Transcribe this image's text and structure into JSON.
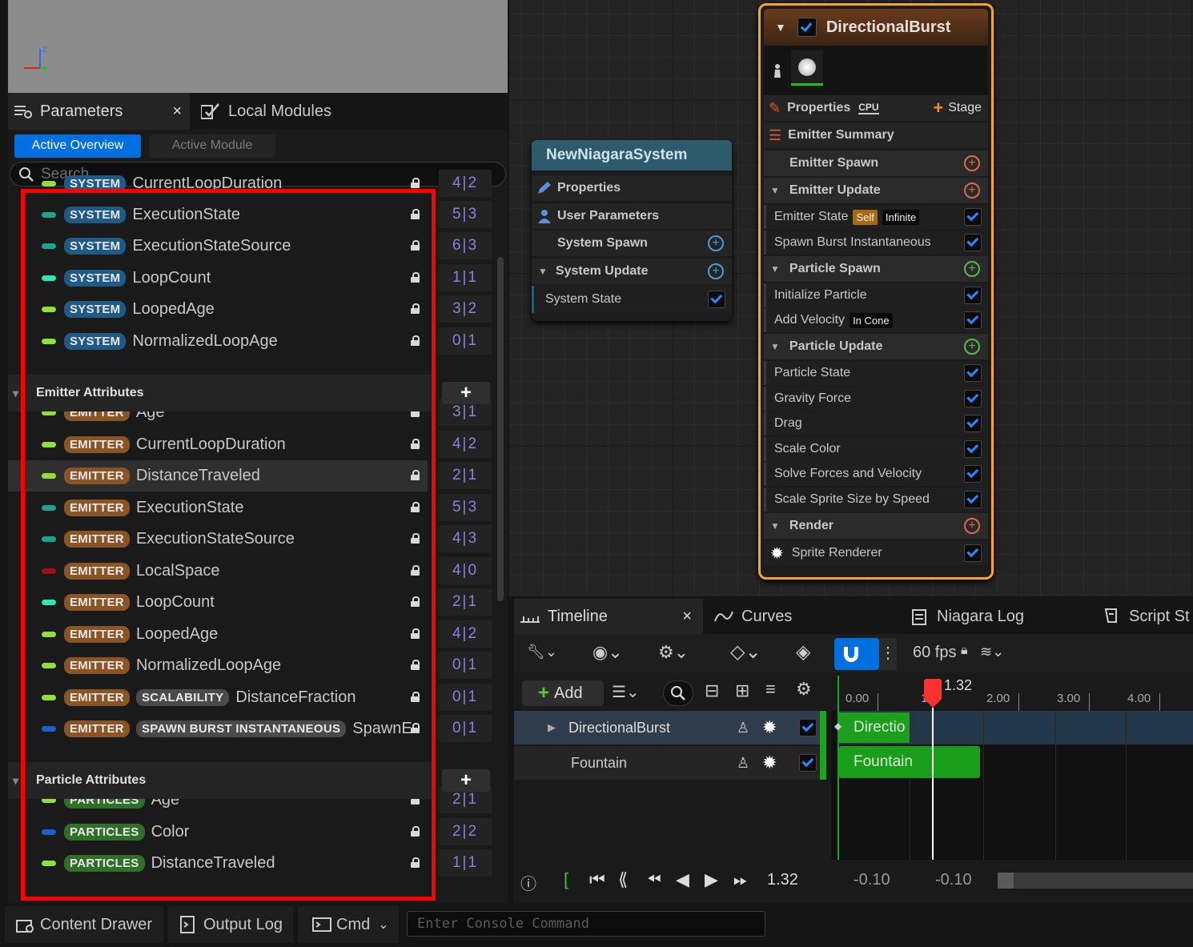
{
  "tabs": {
    "parameters": "Parameters",
    "local_modules": "Local Modules"
  },
  "subtabs": {
    "active_overview": "Active Overview",
    "active_module": "Active Module"
  },
  "search": {
    "placeholder": "Search"
  },
  "system_rows": [
    {
      "tag": "SYSTEM",
      "name": "CurrentLoopDuration",
      "count": "4|2",
      "pill": "#8fe03c"
    },
    {
      "tag": "SYSTEM",
      "name": "ExecutionState",
      "count": "5|3",
      "pill": "#1aa58c"
    },
    {
      "tag": "SYSTEM",
      "name": "ExecutionStateSource",
      "count": "6|3",
      "pill": "#1aa58c"
    },
    {
      "tag": "SYSTEM",
      "name": "LoopCount",
      "count": "1|1",
      "pill": "#2ee6b6"
    },
    {
      "tag": "SYSTEM",
      "name": "LoopedAge",
      "count": "3|2",
      "pill": "#8fe03c"
    },
    {
      "tag": "SYSTEM",
      "name": "NormalizedLoopAge",
      "count": "0|1",
      "pill": "#8fe03c"
    }
  ],
  "emitter_section": "Emitter Attributes",
  "emitter_rows": [
    {
      "tag": "EMITTER",
      "name": "Age",
      "count": "3|1",
      "pill": "#8fe03c"
    },
    {
      "tag": "EMITTER",
      "name": "CurrentLoopDuration",
      "count": "4|2",
      "pill": "#8fe03c"
    },
    {
      "tag": "EMITTER",
      "name": "DistanceTraveled",
      "count": "2|1",
      "pill": "#8fe03c"
    },
    {
      "tag": "EMITTER",
      "name": "ExecutionState",
      "count": "5|3",
      "pill": "#1aa58c"
    },
    {
      "tag": "EMITTER",
      "name": "ExecutionStateSource",
      "count": "4|3",
      "pill": "#1aa58c"
    },
    {
      "tag": "EMITTER",
      "name": "LocalSpace",
      "count": "4|0",
      "pill": "#a01010"
    },
    {
      "tag": "EMITTER",
      "name": "LoopCount",
      "count": "2|1",
      "pill": "#2ee6b6"
    },
    {
      "tag": "EMITTER",
      "name": "LoopedAge",
      "count": "4|2",
      "pill": "#8fe03c"
    },
    {
      "tag": "EMITTER",
      "name": "NormalizedLoopAge",
      "count": "0|1",
      "pill": "#8fe03c"
    },
    {
      "tag": "EMITTER",
      "tag2": "SCALABILITY",
      "name": "DistanceFraction",
      "count": "0|1",
      "pill": "#8fe03c"
    },
    {
      "tag": "EMITTER",
      "tag2": "SPAWN BURST INSTANTANEOUS",
      "name": "SpawnE",
      "count": "0|1",
      "pill": "#1a5fd0"
    }
  ],
  "particle_section": "Particle Attributes",
  "particle_rows": [
    {
      "tag": "PARTICLES",
      "name": "Age",
      "count": "2|1",
      "pill": "#8fe03c"
    },
    {
      "tag": "PARTICLES",
      "name": "Color",
      "count": "2|2",
      "pill": "#1a5fd0"
    },
    {
      "tag": "PARTICLES",
      "name": "DistanceTraveled",
      "count": "1|1",
      "pill": "#8fe03c"
    }
  ],
  "system_node": {
    "title": "NewNiagaraSystem",
    "properties": "Properties",
    "user_parameters": "User Parameters",
    "system_spawn": "System Spawn",
    "system_update": "System Update",
    "system_state": "System State"
  },
  "emitter_node": {
    "title": "DirectionalBurst",
    "properties": "Properties",
    "cpu": "CPU",
    "stage": "Stage",
    "emitter_summary": "Emitter Summary",
    "emitter_spawn": "Emitter Spawn",
    "emitter_update": "Emitter Update",
    "emitter_state": "Emitter State",
    "self_badge": "Self",
    "infinite_badge": "Infinite",
    "spawn_burst": "Spawn Burst Instantaneous",
    "particle_spawn": "Particle Spawn",
    "initialize_particle": "Initialize Particle",
    "add_velocity": "Add Velocity",
    "in_cone_badge": "In Cone",
    "particle_update": "Particle Update",
    "update_modules": [
      "Particle State",
      "Gravity Force",
      "Drag",
      "Scale Color",
      "Solve Forces and Velocity",
      "Scale Sprite Size by Speed"
    ],
    "render": "Render",
    "sprite_renderer": "Sprite Renderer"
  },
  "timeline": {
    "tab_timeline": "Timeline",
    "tab_curves": "Curves",
    "tab_niagara_log": "Niagara Log",
    "tab_script_stats": "Script St",
    "fps": "60 fps",
    "add_label": "Add",
    "playhead_time": "1.32",
    "playhead_marker": "1.",
    "ticks": [
      "0.00",
      "2.00",
      "3.00",
      "4.00"
    ],
    "tracks": [
      "DirectionalBurst",
      "Fountain"
    ],
    "clip_directional": "Directio",
    "clip_fountain": "Fountain",
    "current_time": "1.32",
    "range_start": "-0.10",
    "range_end": "-0.10"
  },
  "bottom": {
    "content_drawer": "Content Drawer",
    "output_log": "Output Log",
    "cmd": "Cmd",
    "console_placeholder": "Enter Console Command"
  },
  "colors": {
    "accent": "#0070e0",
    "highlight_box": "#ff0000",
    "node_selected": "#f5a623"
  }
}
